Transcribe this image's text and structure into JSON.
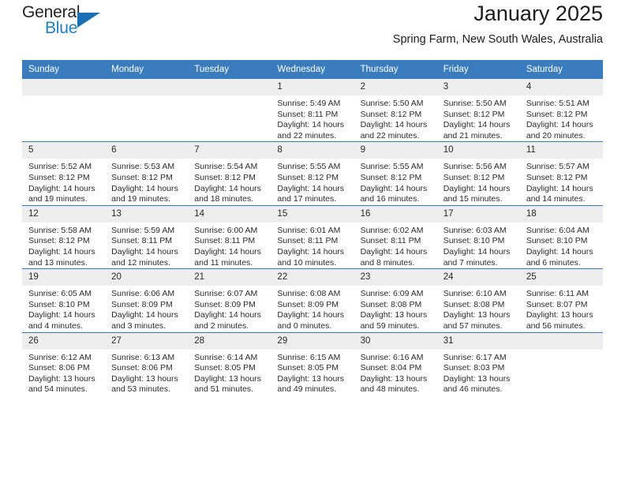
{
  "brand": {
    "name_part1": "General",
    "name_part2": "Blue",
    "logo_icon": "triangle-logo-icon"
  },
  "header": {
    "title": "January 2025",
    "subtitle": "Spring Farm, New South Wales, Australia"
  },
  "colors": {
    "header_blue": "#3a7cbe",
    "daynum_gray": "#eeeeee",
    "brand_blue": "#1f7fc4",
    "text": "#2a2a2a"
  },
  "calendar": {
    "weekday_headers": [
      "Sunday",
      "Monday",
      "Tuesday",
      "Wednesday",
      "Thursday",
      "Friday",
      "Saturday"
    ],
    "labels": {
      "sunrise": "Sunrise:",
      "sunset": "Sunset:",
      "daylight": "Daylight:"
    },
    "weeks": [
      [
        {
          "day": "",
          "blank": true,
          "sunrise": "",
          "sunset": "",
          "daylight_line1": "",
          "daylight_line2": ""
        },
        {
          "day": "",
          "blank": true,
          "sunrise": "",
          "sunset": "",
          "daylight_line1": "",
          "daylight_line2": ""
        },
        {
          "day": "",
          "blank": true,
          "sunrise": "",
          "sunset": "",
          "daylight_line1": "",
          "daylight_line2": ""
        },
        {
          "day": "1",
          "blank": false,
          "sunrise": "Sunrise: 5:49 AM",
          "sunset": "Sunset: 8:11 PM",
          "daylight_line1": "Daylight: 14 hours",
          "daylight_line2": "and 22 minutes."
        },
        {
          "day": "2",
          "blank": false,
          "sunrise": "Sunrise: 5:50 AM",
          "sunset": "Sunset: 8:12 PM",
          "daylight_line1": "Daylight: 14 hours",
          "daylight_line2": "and 22 minutes."
        },
        {
          "day": "3",
          "blank": false,
          "sunrise": "Sunrise: 5:50 AM",
          "sunset": "Sunset: 8:12 PM",
          "daylight_line1": "Daylight: 14 hours",
          "daylight_line2": "and 21 minutes."
        },
        {
          "day": "4",
          "blank": false,
          "sunrise": "Sunrise: 5:51 AM",
          "sunset": "Sunset: 8:12 PM",
          "daylight_line1": "Daylight: 14 hours",
          "daylight_line2": "and 20 minutes."
        }
      ],
      [
        {
          "day": "5",
          "blank": false,
          "sunrise": "Sunrise: 5:52 AM",
          "sunset": "Sunset: 8:12 PM",
          "daylight_line1": "Daylight: 14 hours",
          "daylight_line2": "and 19 minutes."
        },
        {
          "day": "6",
          "blank": false,
          "sunrise": "Sunrise: 5:53 AM",
          "sunset": "Sunset: 8:12 PM",
          "daylight_line1": "Daylight: 14 hours",
          "daylight_line2": "and 19 minutes."
        },
        {
          "day": "7",
          "blank": false,
          "sunrise": "Sunrise: 5:54 AM",
          "sunset": "Sunset: 8:12 PM",
          "daylight_line1": "Daylight: 14 hours",
          "daylight_line2": "and 18 minutes."
        },
        {
          "day": "8",
          "blank": false,
          "sunrise": "Sunrise: 5:55 AM",
          "sunset": "Sunset: 8:12 PM",
          "daylight_line1": "Daylight: 14 hours",
          "daylight_line2": "and 17 minutes."
        },
        {
          "day": "9",
          "blank": false,
          "sunrise": "Sunrise: 5:55 AM",
          "sunset": "Sunset: 8:12 PM",
          "daylight_line1": "Daylight: 14 hours",
          "daylight_line2": "and 16 minutes."
        },
        {
          "day": "10",
          "blank": false,
          "sunrise": "Sunrise: 5:56 AM",
          "sunset": "Sunset: 8:12 PM",
          "daylight_line1": "Daylight: 14 hours",
          "daylight_line2": "and 15 minutes."
        },
        {
          "day": "11",
          "blank": false,
          "sunrise": "Sunrise: 5:57 AM",
          "sunset": "Sunset: 8:12 PM",
          "daylight_line1": "Daylight: 14 hours",
          "daylight_line2": "and 14 minutes."
        }
      ],
      [
        {
          "day": "12",
          "blank": false,
          "sunrise": "Sunrise: 5:58 AM",
          "sunset": "Sunset: 8:12 PM",
          "daylight_line1": "Daylight: 14 hours",
          "daylight_line2": "and 13 minutes."
        },
        {
          "day": "13",
          "blank": false,
          "sunrise": "Sunrise: 5:59 AM",
          "sunset": "Sunset: 8:11 PM",
          "daylight_line1": "Daylight: 14 hours",
          "daylight_line2": "and 12 minutes."
        },
        {
          "day": "14",
          "blank": false,
          "sunrise": "Sunrise: 6:00 AM",
          "sunset": "Sunset: 8:11 PM",
          "daylight_line1": "Daylight: 14 hours",
          "daylight_line2": "and 11 minutes."
        },
        {
          "day": "15",
          "blank": false,
          "sunrise": "Sunrise: 6:01 AM",
          "sunset": "Sunset: 8:11 PM",
          "daylight_line1": "Daylight: 14 hours",
          "daylight_line2": "and 10 minutes."
        },
        {
          "day": "16",
          "blank": false,
          "sunrise": "Sunrise: 6:02 AM",
          "sunset": "Sunset: 8:11 PM",
          "daylight_line1": "Daylight: 14 hours",
          "daylight_line2": "and 8 minutes."
        },
        {
          "day": "17",
          "blank": false,
          "sunrise": "Sunrise: 6:03 AM",
          "sunset": "Sunset: 8:10 PM",
          "daylight_line1": "Daylight: 14 hours",
          "daylight_line2": "and 7 minutes."
        },
        {
          "day": "18",
          "blank": false,
          "sunrise": "Sunrise: 6:04 AM",
          "sunset": "Sunset: 8:10 PM",
          "daylight_line1": "Daylight: 14 hours",
          "daylight_line2": "and 6 minutes."
        }
      ],
      [
        {
          "day": "19",
          "blank": false,
          "sunrise": "Sunrise: 6:05 AM",
          "sunset": "Sunset: 8:10 PM",
          "daylight_line1": "Daylight: 14 hours",
          "daylight_line2": "and 4 minutes."
        },
        {
          "day": "20",
          "blank": false,
          "sunrise": "Sunrise: 6:06 AM",
          "sunset": "Sunset: 8:09 PM",
          "daylight_line1": "Daylight: 14 hours",
          "daylight_line2": "and 3 minutes."
        },
        {
          "day": "21",
          "blank": false,
          "sunrise": "Sunrise: 6:07 AM",
          "sunset": "Sunset: 8:09 PM",
          "daylight_line1": "Daylight: 14 hours",
          "daylight_line2": "and 2 minutes."
        },
        {
          "day": "22",
          "blank": false,
          "sunrise": "Sunrise: 6:08 AM",
          "sunset": "Sunset: 8:09 PM",
          "daylight_line1": "Daylight: 14 hours",
          "daylight_line2": "and 0 minutes."
        },
        {
          "day": "23",
          "blank": false,
          "sunrise": "Sunrise: 6:09 AM",
          "sunset": "Sunset: 8:08 PM",
          "daylight_line1": "Daylight: 13 hours",
          "daylight_line2": "and 59 minutes."
        },
        {
          "day": "24",
          "blank": false,
          "sunrise": "Sunrise: 6:10 AM",
          "sunset": "Sunset: 8:08 PM",
          "daylight_line1": "Daylight: 13 hours",
          "daylight_line2": "and 57 minutes."
        },
        {
          "day": "25",
          "blank": false,
          "sunrise": "Sunrise: 6:11 AM",
          "sunset": "Sunset: 8:07 PM",
          "daylight_line1": "Daylight: 13 hours",
          "daylight_line2": "and 56 minutes."
        }
      ],
      [
        {
          "day": "26",
          "blank": false,
          "sunrise": "Sunrise: 6:12 AM",
          "sunset": "Sunset: 8:06 PM",
          "daylight_line1": "Daylight: 13 hours",
          "daylight_line2": "and 54 minutes."
        },
        {
          "day": "27",
          "blank": false,
          "sunrise": "Sunrise: 6:13 AM",
          "sunset": "Sunset: 8:06 PM",
          "daylight_line1": "Daylight: 13 hours",
          "daylight_line2": "and 53 minutes."
        },
        {
          "day": "28",
          "blank": false,
          "sunrise": "Sunrise: 6:14 AM",
          "sunset": "Sunset: 8:05 PM",
          "daylight_line1": "Daylight: 13 hours",
          "daylight_line2": "and 51 minutes."
        },
        {
          "day": "29",
          "blank": false,
          "sunrise": "Sunrise: 6:15 AM",
          "sunset": "Sunset: 8:05 PM",
          "daylight_line1": "Daylight: 13 hours",
          "daylight_line2": "and 49 minutes."
        },
        {
          "day": "30",
          "blank": false,
          "sunrise": "Sunrise: 6:16 AM",
          "sunset": "Sunset: 8:04 PM",
          "daylight_line1": "Daylight: 13 hours",
          "daylight_line2": "and 48 minutes."
        },
        {
          "day": "31",
          "blank": false,
          "sunrise": "Sunrise: 6:17 AM",
          "sunset": "Sunset: 8:03 PM",
          "daylight_line1": "Daylight: 13 hours",
          "daylight_line2": "and 46 minutes."
        },
        {
          "day": "",
          "blank": true,
          "sunrise": "",
          "sunset": "",
          "daylight_line1": "",
          "daylight_line2": ""
        }
      ]
    ]
  }
}
